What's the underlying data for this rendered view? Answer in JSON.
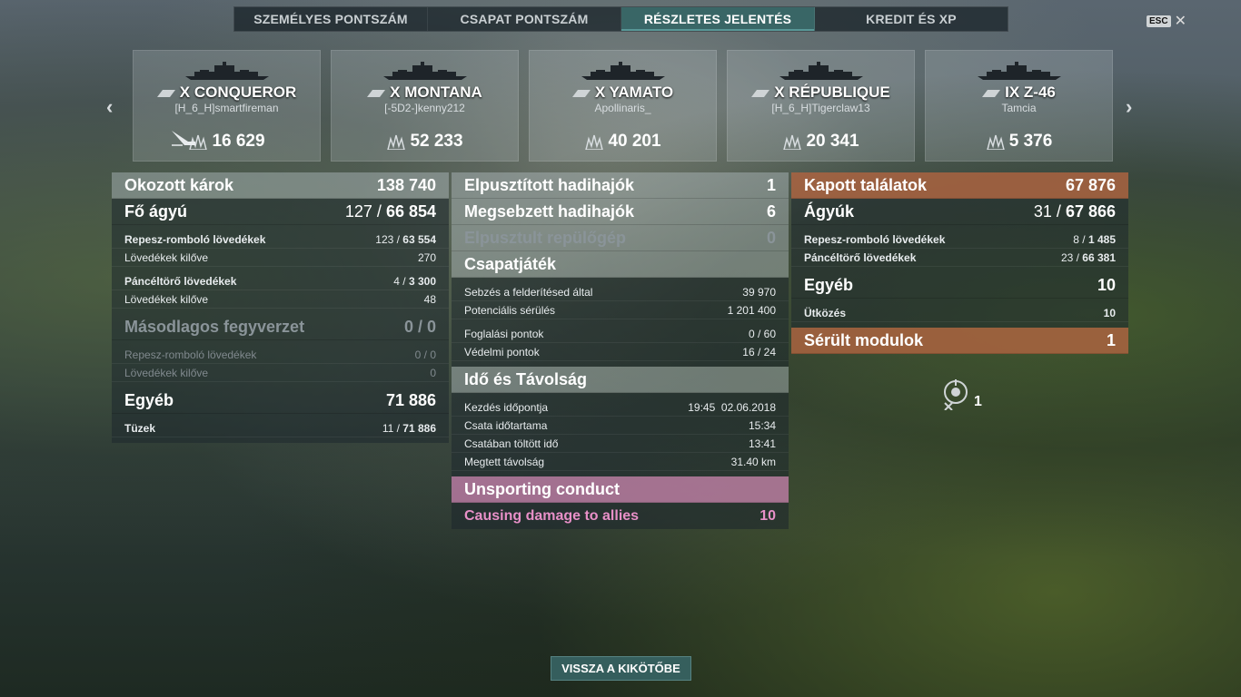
{
  "tabs": [
    "SZEMÉLYES PONTSZÁM",
    "CSAPAT PONTSZÁM",
    "RÉSZLETES JELENTÉS",
    "KREDIT ÉS XP"
  ],
  "esc_label": "ESC",
  "ships": [
    {
      "name": "X CONQUEROR",
      "player": "[H_6_H]smartfireman",
      "damage": "16 629",
      "sunk": true
    },
    {
      "name": "X MONTANA",
      "player": "[-5D2-]kenny212",
      "damage": "52 233",
      "sunk": false
    },
    {
      "name": "X YAMATO",
      "player": "Apollinaris_",
      "damage": "40 201",
      "sunk": false
    },
    {
      "name": "X RÉPUBLIQUE",
      "player": "[H_6_H]Tigerclaw13",
      "damage": "20 341",
      "sunk": false
    },
    {
      "name": "IX Z-46",
      "player": "Tamcia",
      "damage": "5 376",
      "sunk": false
    }
  ],
  "left": {
    "dealt_label": "Okozott károk",
    "dealt_val": "138 740",
    "main_label": "Fő ágyú",
    "main_hits": "127 / ",
    "main_dmg": "66 854",
    "he_label": "Repesz-romboló lövedékek",
    "he_hits": "123 / ",
    "he_dmg": "63 554",
    "he_fired_label": "Lövedékek kilőve",
    "he_fired": "270",
    "ap_label": "Páncéltörő lövedékek",
    "ap_hits": "4 / ",
    "ap_dmg": "3 300",
    "ap_fired_label": "Lövedékek kilőve",
    "ap_fired": "48",
    "sec_label": "Másodlagos fegyverzet",
    "sec_val": "0 / 0",
    "sec_he_label": "Repesz-romboló lövedékek",
    "sec_he_val": "0 / 0",
    "sec_fired_label": "Lövedékek kilőve",
    "sec_fired": "0",
    "other_label": "Egyéb",
    "other_val": "71 886",
    "fire_label": "Tüzek",
    "fire_hits": "11 / ",
    "fire_dmg": "71 886"
  },
  "mid": {
    "destroyed_label": "Elpusztított hadihajók",
    "destroyed_val": "1",
    "damaged_label": "Megsebzett hadihajók",
    "damaged_val": "6",
    "planes_label": "Elpusztult repülőgép",
    "planes_val": "0",
    "team_label": "Csapatjáték",
    "spot_label": "Sebzés a felderítésed által",
    "spot_val": "39 970",
    "pot_label": "Potenciális sérülés",
    "pot_val": "1 201 400",
    "cap_label": "Foglalási pontok",
    "cap_val": "0 / 60",
    "def_label": "Védelmi pontok",
    "def_val": "16 / 24",
    "time_label": "Idő és Távolság",
    "start_label": "Kezdés időpontja",
    "start_val": "19:45  02.06.2018",
    "dur_label": "Csata időtartama",
    "dur_val": "15:34",
    "spent_label": "Csatában töltött idő",
    "spent_val": "13:41",
    "dist_label": "Megtett távolság",
    "dist_val": "31.40 km",
    "unsport_label": "Unsporting conduct",
    "allies_label": "Causing damage to allies",
    "allies_val": "10"
  },
  "right": {
    "recv_label": "Kapott találatok",
    "recv_val": "67 876",
    "guns_label": "Ágyúk",
    "guns_hits": "31 / ",
    "guns_dmg": "67 866",
    "he_label": "Repesz-romboló lövedékek",
    "he_hits": "8 / ",
    "he_dmg": "1 485",
    "ap_label": "Páncéltörő lövedékek",
    "ap_hits": "23 / ",
    "ap_dmg": "66 381",
    "other_label": "Egyéb",
    "other_val": "10",
    "ram_label": "Ütközés",
    "ram_val": "10",
    "mod_label": "Sérült modulok",
    "mod_val": "1",
    "mod_count": "1"
  },
  "back_label": "VISSZA A KIKÖTŐBE"
}
